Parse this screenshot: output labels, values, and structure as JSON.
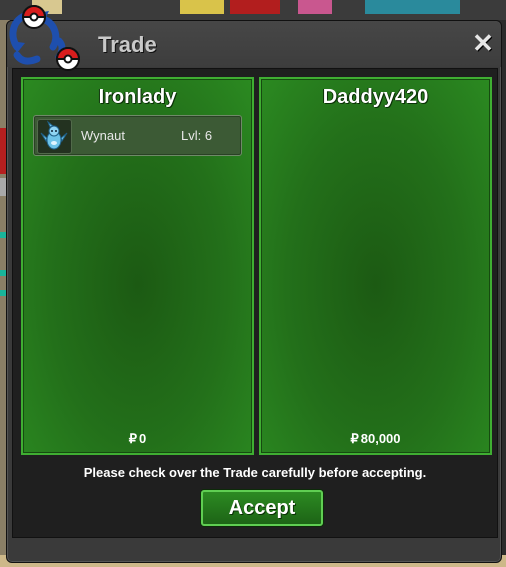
{
  "window": {
    "title": "Trade",
    "close_icon": "close-icon",
    "trade_icon": "pokeball-swap-icon"
  },
  "left_panel": {
    "player_name": "Ironlady",
    "money_symbol": "₽",
    "money": "0",
    "pokemon": [
      {
        "name": "Wynaut",
        "level": "Lvl: 6",
        "icon": "wynaut-sprite-icon"
      }
    ]
  },
  "right_panel": {
    "player_name": "Daddyy420",
    "money_symbol": "₽",
    "money": "80,000",
    "pokemon": []
  },
  "notice": "Please check over the Trade carefully before accepting.",
  "accept_label": "Accept",
  "colors": {
    "panel_green": "#23701a",
    "panel_border": "#3fae32",
    "accept_bg": "#2c8a22",
    "window_bg": "#3a3a3a"
  }
}
